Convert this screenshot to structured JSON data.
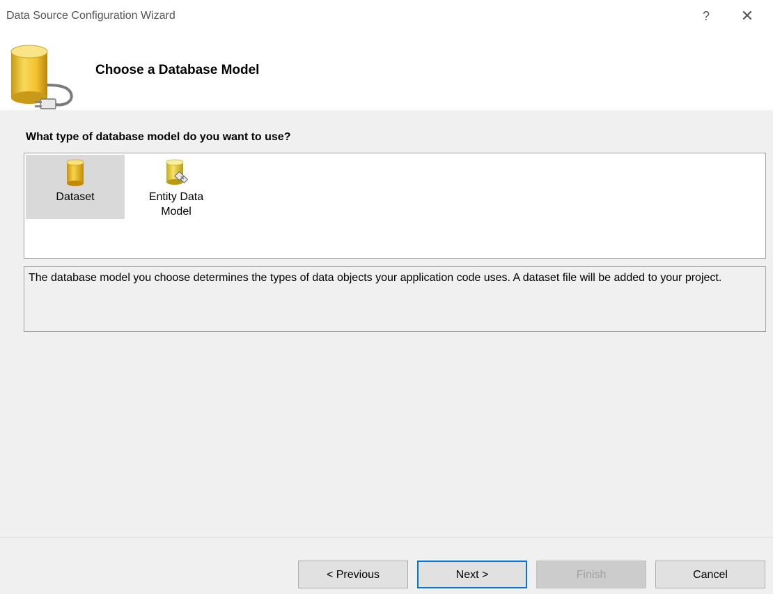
{
  "window": {
    "title": "Data Source Configuration Wizard",
    "help_label": "?",
    "close_label": "✕"
  },
  "header": {
    "title": "Choose a Database Model"
  },
  "content": {
    "question": "What type of database model do you want to use?",
    "models": [
      {
        "label": "Dataset",
        "selected": true,
        "icon": "database-icon"
      },
      {
        "label": "Entity Data Model",
        "selected": false,
        "icon": "entity-data-model-icon"
      }
    ],
    "description": "The database model you choose determines the types of data objects your application code uses. A dataset file will be added to your project."
  },
  "footer": {
    "previous_label": "< Previous",
    "next_label": "Next >",
    "finish_label": "Finish",
    "cancel_label": "Cancel"
  },
  "colors": {
    "accent": "#0078d7",
    "database_yellow": "#f2c12e",
    "selection": "#d9d9d9"
  }
}
